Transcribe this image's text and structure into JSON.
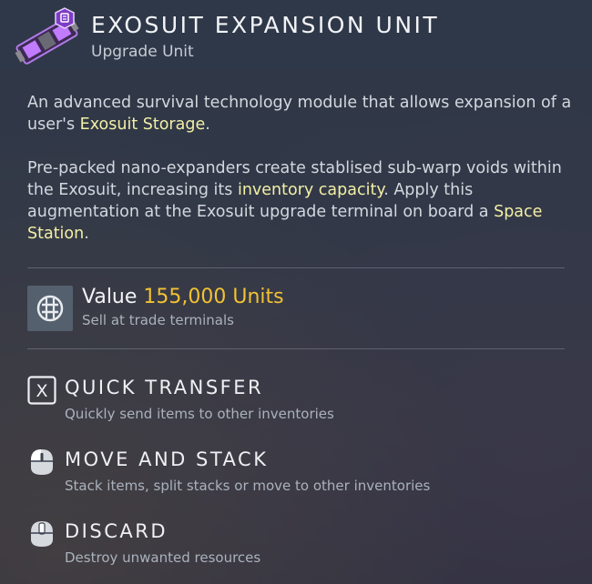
{
  "header": {
    "title": "EXOSUIT EXPANSION UNIT",
    "subtitle": "Upgrade Unit",
    "icon": "exosuit-expansion-unit-icon"
  },
  "description": {
    "paragraph1": {
      "before": "An advanced survival technology module that allows expansion of a user's ",
      "highlight": "Exosuit Storage",
      "after": "."
    },
    "paragraph2": {
      "text1": "Pre-packed nano-expanders create stablised sub-warp voids within the Exosuit, increasing its ",
      "highlight1": "inventory capacity",
      "text2": ". Apply this augmentation at the Exosuit upgrade terminal on board a ",
      "highlight2": "Space Station",
      "text3": "."
    }
  },
  "value": {
    "label": "Value",
    "amount": "155,000 Units",
    "note": "Sell at trade terminals",
    "icon": "units-currency-icon"
  },
  "actions": [
    {
      "key": "X",
      "title": "QUICK TRANSFER",
      "description": "Quickly send items to other inventories",
      "icon": "x-key-icon"
    },
    {
      "title": "MOVE AND STACK",
      "description": "Stack items, split stacks or move to other inventories",
      "icon": "mouse-left-icon"
    },
    {
      "title": "DISCARD",
      "description": "Destroy unwanted resources",
      "icon": "mouse-middle-icon"
    }
  ],
  "colors": {
    "highlight": "#f3efa6",
    "value_amount": "#f2c232",
    "item_accent": "#9b4fd6"
  }
}
